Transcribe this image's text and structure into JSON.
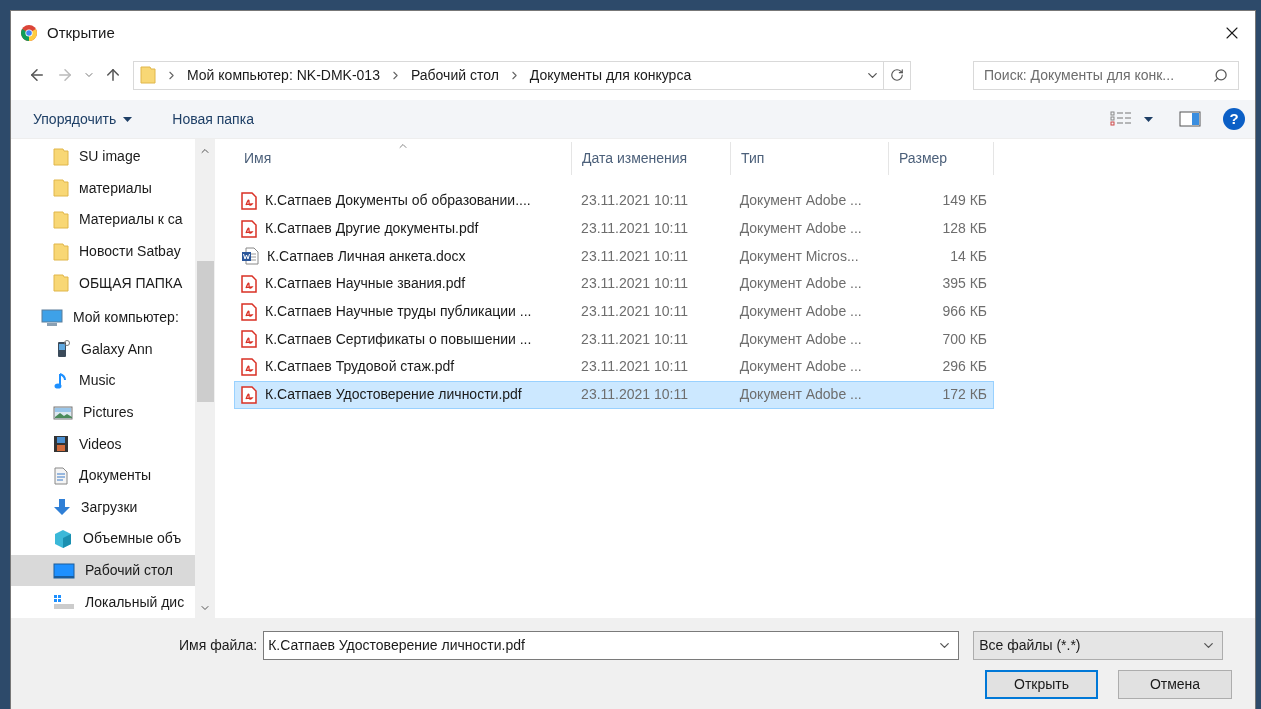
{
  "window": {
    "title": "Открытие"
  },
  "address": {
    "crumbs": [
      "Мой компьютер: NK-DMK-013",
      "Рабочий стол",
      "Документы для конкурса"
    ]
  },
  "search": {
    "placeholder": "Поиск: Документы для конк..."
  },
  "toolbar": {
    "organize": "Упорядочить",
    "new_folder": "Новая папка",
    "help": "?"
  },
  "sidebar": {
    "items": [
      {
        "label": "SU image",
        "kind": "folder",
        "selected": false
      },
      {
        "label": "материалы",
        "kind": "folder",
        "selected": false
      },
      {
        "label": "Материалы к са",
        "kind": "folder",
        "selected": false
      },
      {
        "label": "Новости Satbay",
        "kind": "folder",
        "selected": false
      },
      {
        "label": "ОБЩАЯ ПАПКА",
        "kind": "folder",
        "selected": false
      },
      {
        "label": "Мой компьютер:",
        "kind": "computer",
        "selected": false,
        "children": [
          {
            "label": "Galaxy Ann",
            "kind": "phone",
            "selected": false
          },
          {
            "label": "Music",
            "kind": "music",
            "selected": false
          },
          {
            "label": "Pictures",
            "kind": "pictures",
            "selected": false
          },
          {
            "label": "Videos",
            "kind": "videos",
            "selected": false
          },
          {
            "label": "Документы",
            "kind": "documents",
            "selected": false
          },
          {
            "label": "Загрузки",
            "kind": "downloads",
            "selected": false
          },
          {
            "label": "Объемные объ",
            "kind": "cube",
            "selected": false
          },
          {
            "label": "Рабочий стол",
            "kind": "desktop",
            "selected": true
          },
          {
            "label": "Локальный дис",
            "kind": "drive",
            "selected": false
          }
        ]
      }
    ]
  },
  "table": {
    "columns": [
      "Имя",
      "Дата изменения",
      "Тип",
      "Размер"
    ],
    "rows": [
      {
        "name": "К.Сатпаев Документы об образовании....",
        "date": "23.11.2021 10:11",
        "type": "Документ Adobe ...",
        "size": "149 КБ",
        "kind": "pdf",
        "selected": false
      },
      {
        "name": "К.Сатпаев Другие документы.pdf",
        "date": "23.11.2021 10:11",
        "type": "Документ Adobe ...",
        "size": "128 КБ",
        "kind": "pdf",
        "selected": false
      },
      {
        "name": "К.Сатпаев Личная анкета.docx",
        "date": "23.11.2021 10:11",
        "type": "Документ Micros...",
        "size": "14 КБ",
        "kind": "word",
        "selected": false
      },
      {
        "name": "К.Сатпаев Научные звания.pdf",
        "date": "23.11.2021 10:11",
        "type": "Документ Adobe ...",
        "size": "395 КБ",
        "kind": "pdf",
        "selected": false
      },
      {
        "name": "К.Сатпаев Научные труды публикации ...",
        "date": "23.11.2021 10:11",
        "type": "Документ Adobe ...",
        "size": "966 КБ",
        "kind": "pdf",
        "selected": false
      },
      {
        "name": "К.Сатпаев Сертификаты о повышении ...",
        "date": "23.11.2021 10:11",
        "type": "Документ Adobe ...",
        "size": "700 КБ",
        "kind": "pdf",
        "selected": false
      },
      {
        "name": "К.Сатпаев Трудовой стаж.pdf",
        "date": "23.11.2021 10:11",
        "type": "Документ Adobe ...",
        "size": "296 КБ",
        "kind": "pdf",
        "selected": false
      },
      {
        "name": "К.Сатпаев Удостоверение личности.pdf",
        "date": "23.11.2021 10:11",
        "type": "Документ Adobe ...",
        "size": "172 КБ",
        "kind": "pdf",
        "selected": true
      }
    ]
  },
  "footer": {
    "filename_label": "Имя файла:",
    "filename": "К.Сатпаев Удостоверение личности.pdf",
    "filter": "Все файлы (*.*)",
    "open": "Открыть",
    "cancel": "Отмена"
  }
}
